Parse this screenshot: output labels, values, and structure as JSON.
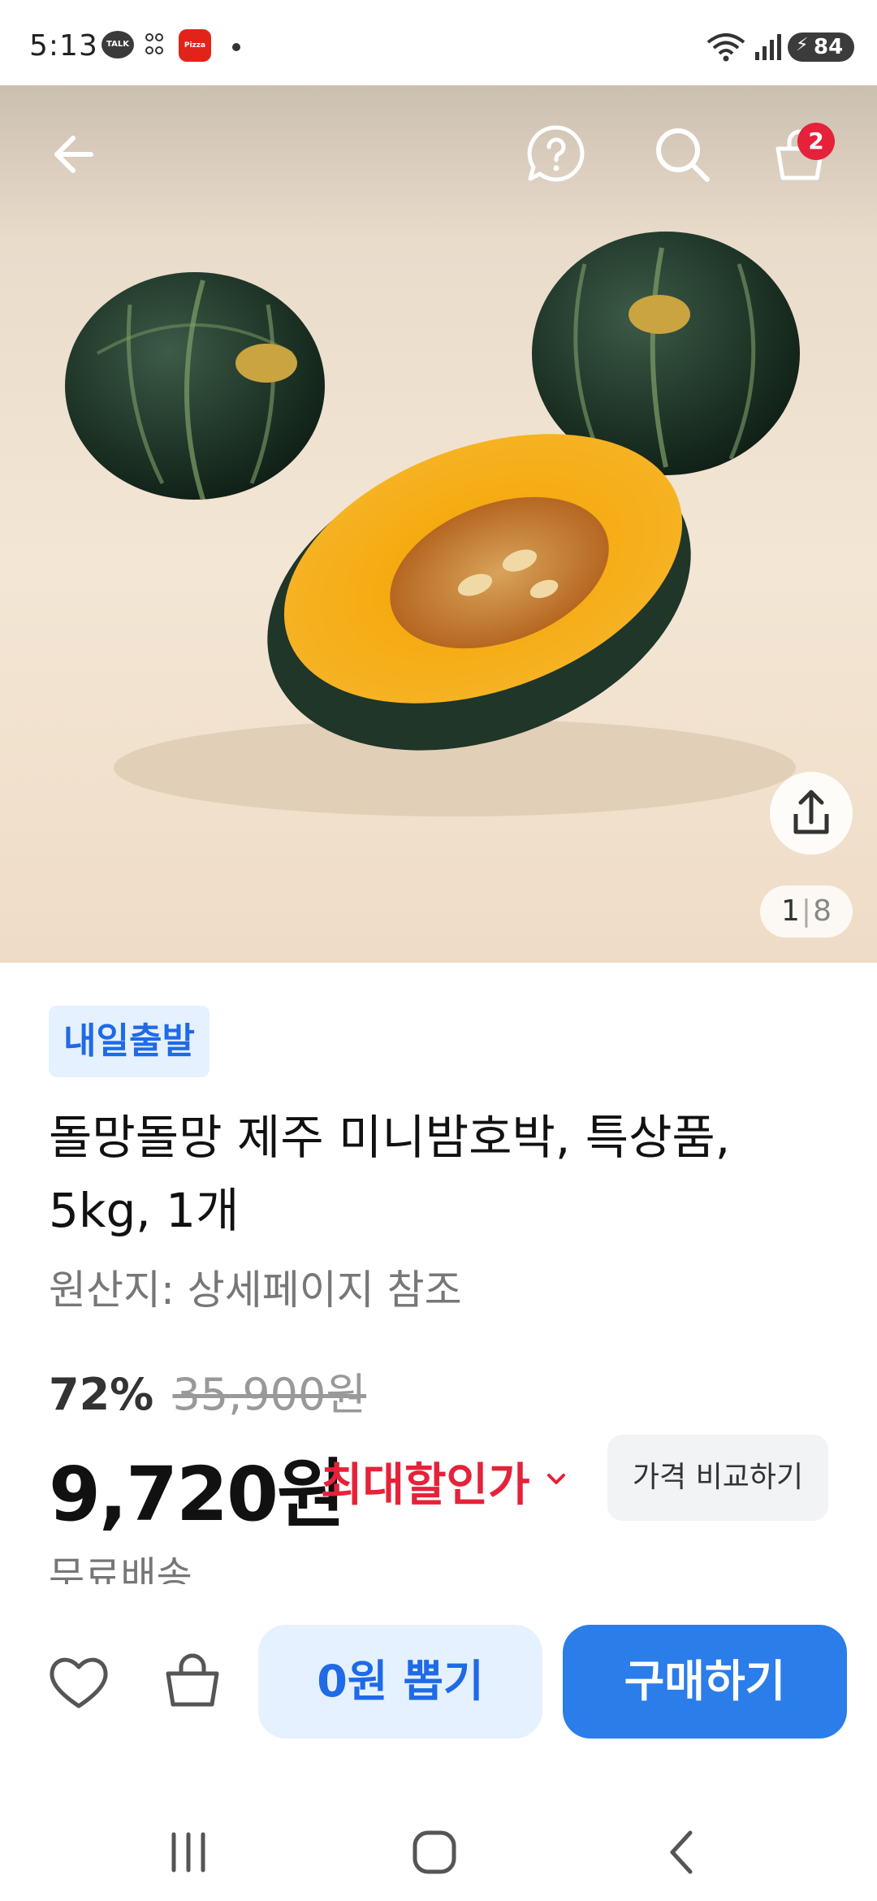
{
  "status_bar": {
    "time": "5:13",
    "talk_label": "TALK",
    "pizza_label": "Pizza Hut",
    "battery": "84"
  },
  "hero": {
    "page_current": "1",
    "page_total": "8",
    "cart_count": "2"
  },
  "product": {
    "delivery_badge": "내일출발",
    "title": "돌망돌망 제주 미니밤호박, 특상품, 5kg, 1개",
    "origin": "원산지: 상세페이지 참조",
    "discount_rate": "72%",
    "original_price": "35,900원",
    "sale_price": "9,720원",
    "max_discount_label": "최대할인가",
    "compare_button": "가격 비교하기",
    "shipping": "무료배송"
  },
  "actions": {
    "free_draw": "0원 뽑기",
    "buy": "구매하기"
  },
  "colors": {
    "accent_blue": "#2b7de9",
    "light_blue": "#e6f1ff",
    "sale_red": "#e5223a"
  },
  "icons": [
    "back-arrow-icon",
    "help-bubble-icon",
    "search-icon",
    "cart-icon",
    "share-icon",
    "heart-icon",
    "shopping-bag-icon",
    "chevron-down-icon"
  ]
}
